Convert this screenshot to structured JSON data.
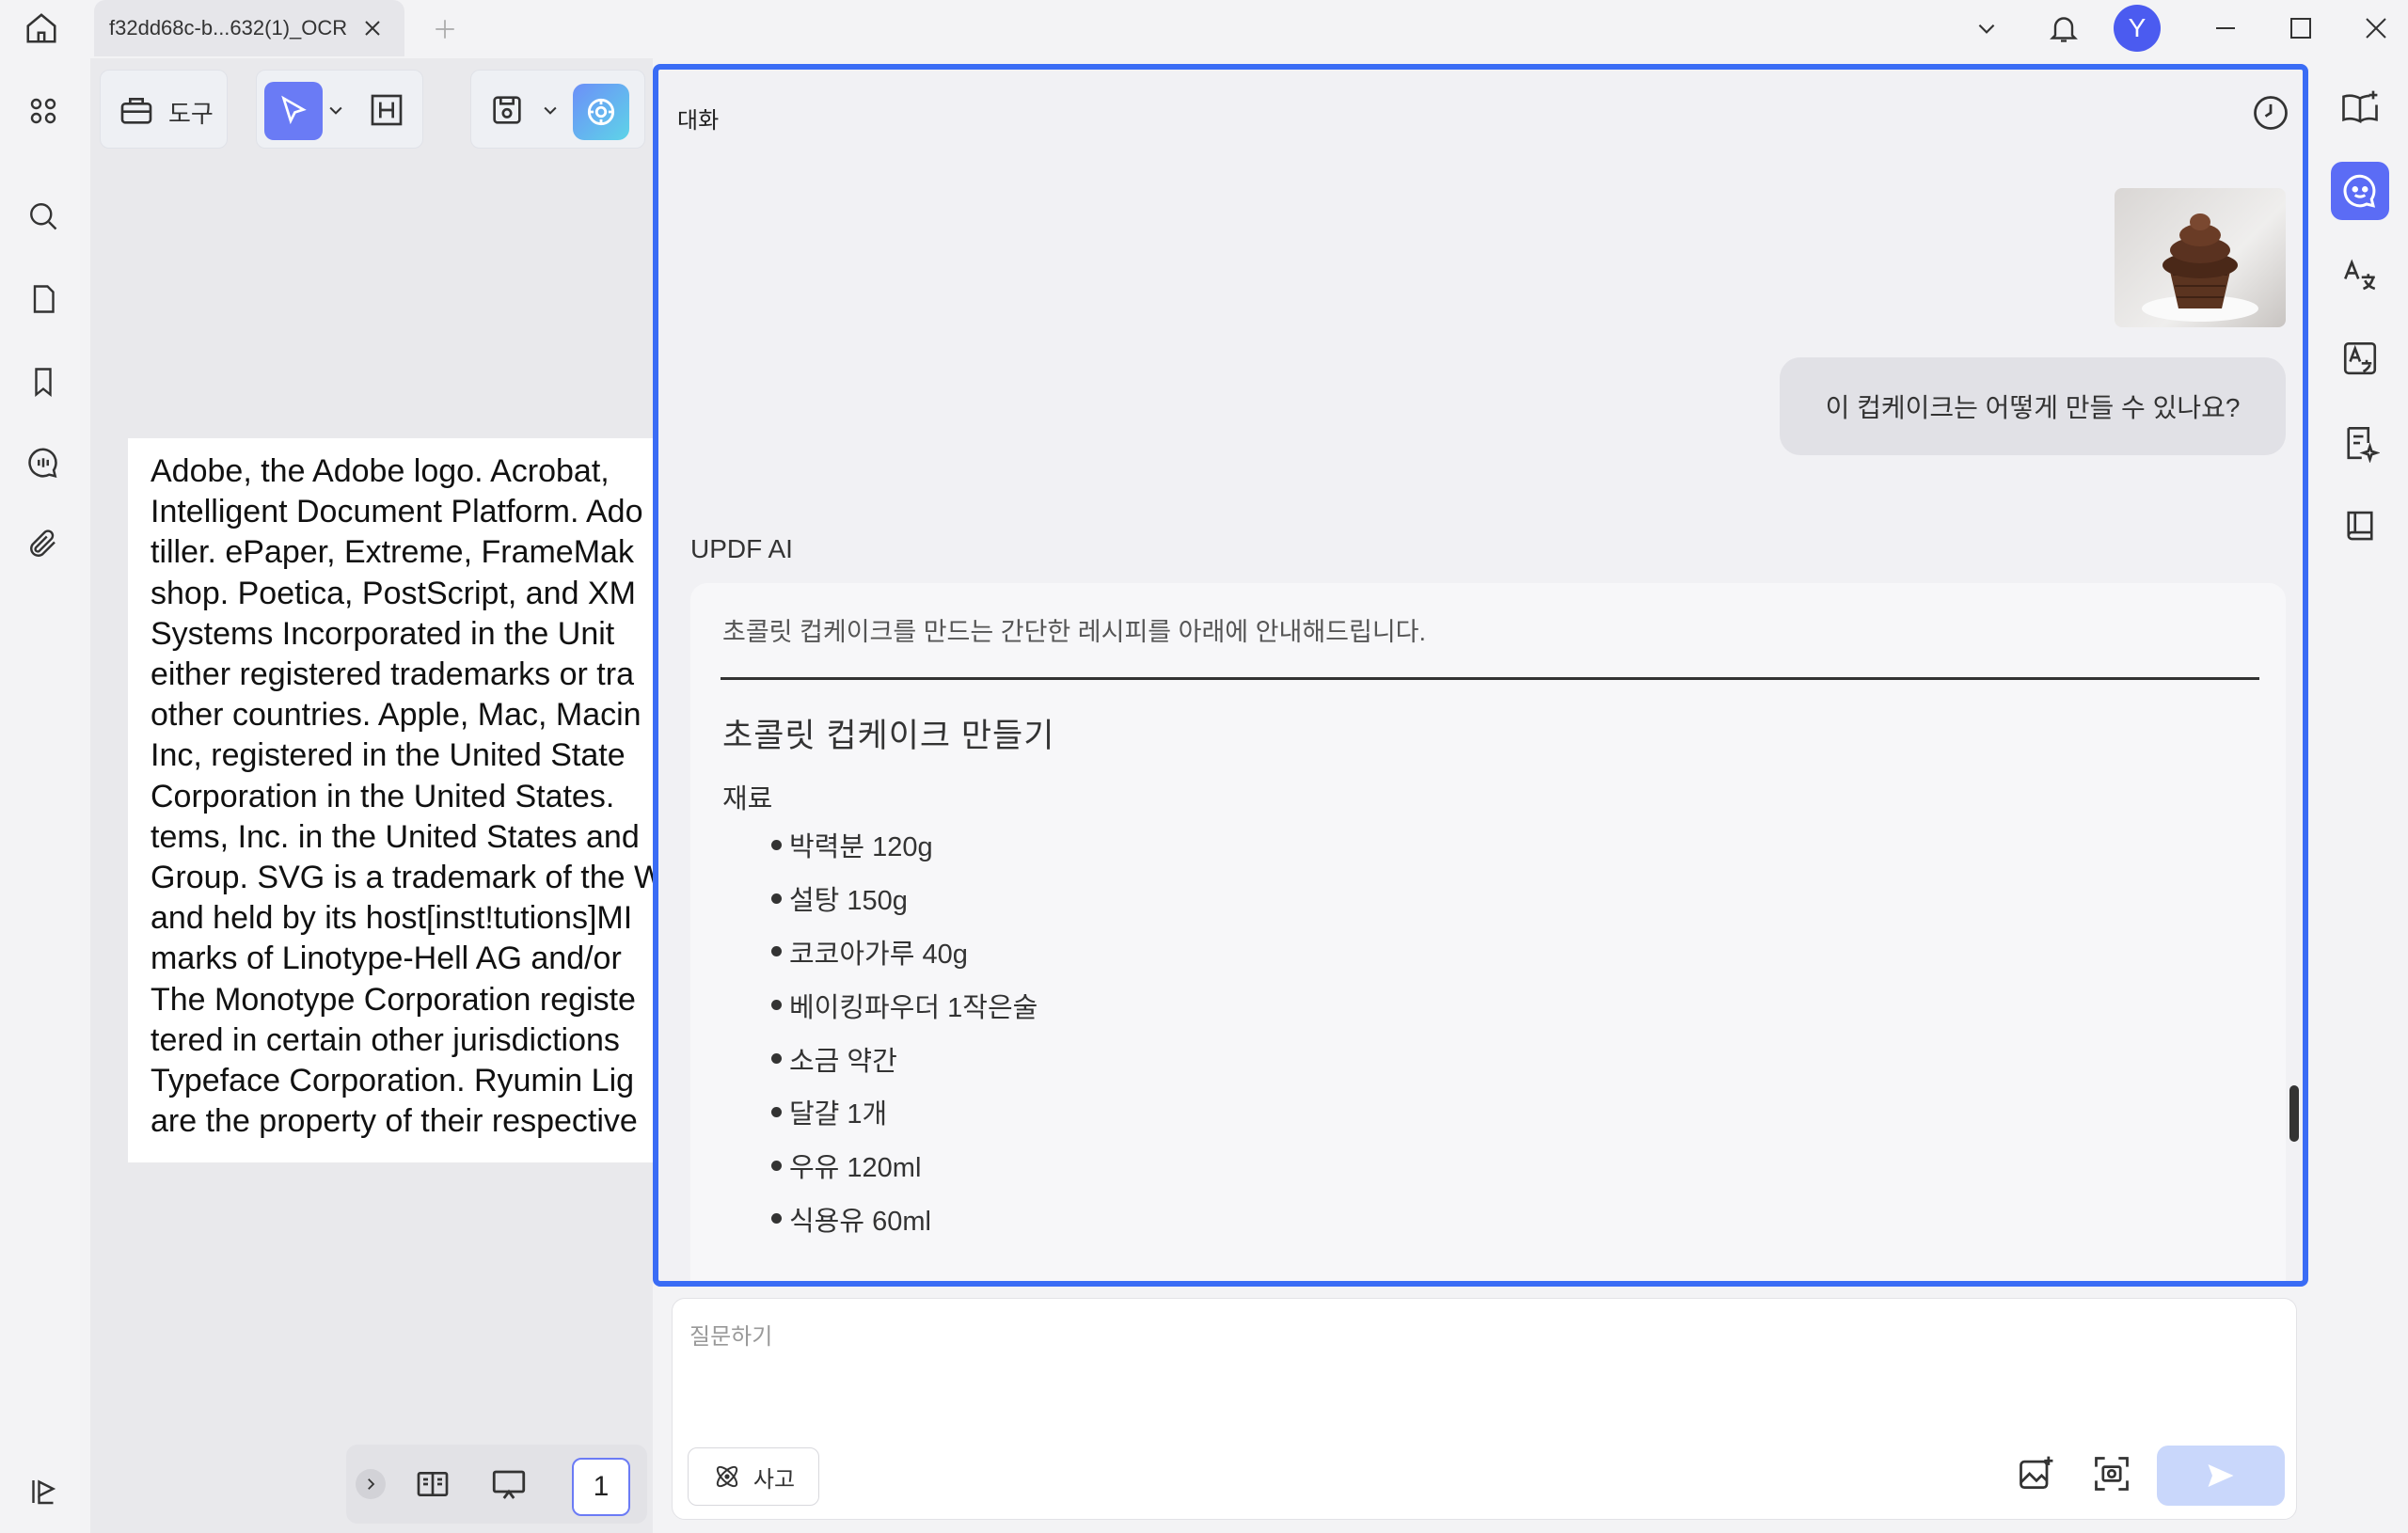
{
  "titlebar": {
    "tab_title": "f32dd68c-b...632(1)_OCR",
    "avatar_initial": "Y"
  },
  "toolbar": {
    "tools_label": "도구"
  },
  "document": {
    "lines": [
      "Adobe, the Adobe logo. Acrobat,",
      "Intelligent Document Platform. Ado",
      "tiller. ePaper, Extreme, FrameMak",
      "shop. Poetica, PostScript, and XM",
      "Systems Incorporated in the Unit",
      "either registered trademarks or tra",
      "other countries. Apple, Mac, Macin",
      "Inc, registered in the United State",
      "Corporation in the United States.",
      "tems, Inc. in the United States and",
      "Group. SVG is a trademark of the W",
      "and held by its host[inst!tutions]MI",
      "marks of Linotype-Hell AG and/or",
      "The Monotype Corporation registe",
      "tered in certain other jurisdictions",
      "Typeface Corporation. Ryumin Lig",
      "are the property of their respective"
    ],
    "page_number": "1"
  },
  "chat": {
    "title": "대화",
    "user_message": "이 컵케이크는 어떻게 만들 수 있나요?",
    "ai_label": "UPDF AI",
    "ai_intro": "초콜릿 컵케이크를 만드는 간단한 레시피를 아래에 안내해드립니다.",
    "ai_heading": "초콜릿 컵케이크 만들기",
    "ai_subheading": "재료",
    "ingredients": [
      "박력분 120g",
      "설탕 150g",
      "코코아가루 40g",
      "베이킹파우더 1작은술",
      "소금 약간",
      "달걀 1개",
      "우유 120ml",
      "식용유 60ml"
    ]
  },
  "input": {
    "placeholder": "질문하기",
    "think_label": "사고"
  },
  "colors": {
    "accent": "#3a6cf5",
    "active_icon_bg": "#5b6cf5",
    "send_disabled": "#c9d7fb"
  }
}
